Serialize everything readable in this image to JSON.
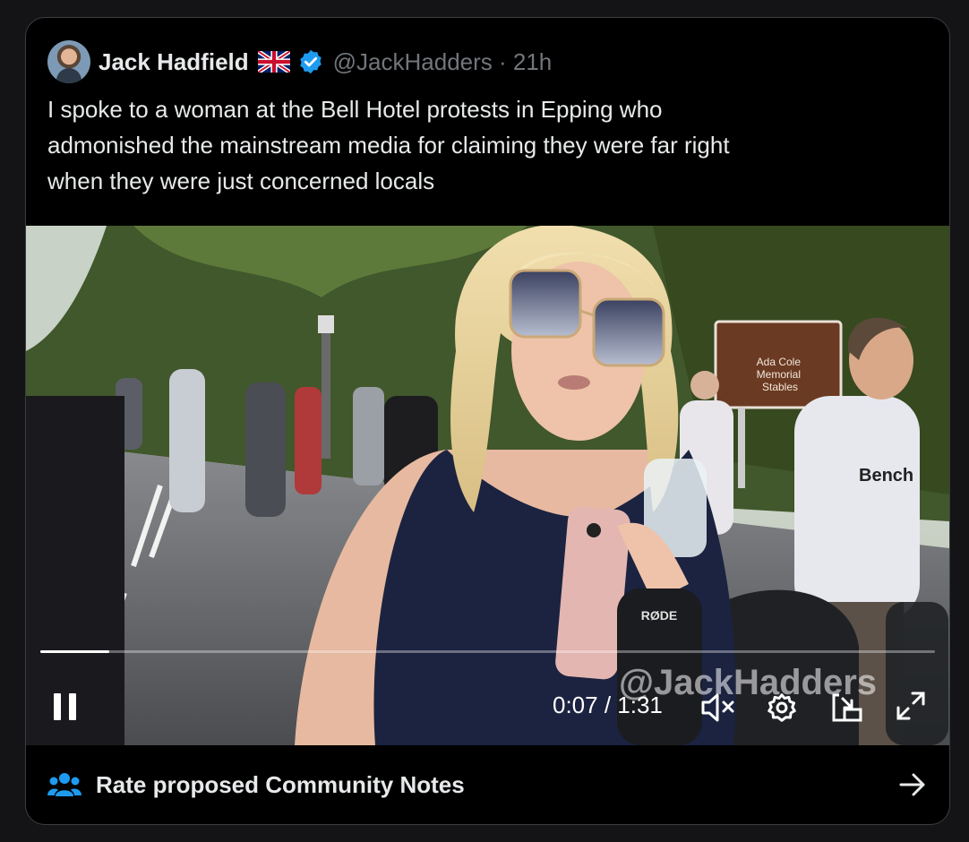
{
  "tweet": {
    "author_name": "Jack Hadfield",
    "handle_time": "@JackHadders · 21h",
    "text": "I spoke to a woman at the Bell Hotel protests in Epping who\nadmonished the mainstream media for claiming they were far right\nwhen they were just concerned locals"
  },
  "video": {
    "watermark": "@JackHadders",
    "current_time": "0:07",
    "duration": "1:31",
    "time_display": "0:07 / 1:31",
    "progress_fraction": 0.077,
    "sign_text": "Ada Cole\nMemorial\nStables",
    "shirt_text": "Bench",
    "mic_text": "RØDE"
  },
  "icons": {
    "author_flag": "uk-flag-icon",
    "verified": "verified-badge-icon",
    "pause": "pause-icon",
    "mute": "volume-muted-icon",
    "settings": "gear-icon",
    "minimize": "pop-out-icon",
    "fullscreen": "fullscreen-icon",
    "community": "community-notes-icon",
    "arrow": "arrow-right-icon"
  },
  "community_notes": {
    "label": "Rate proposed Community Notes"
  },
  "colors": {
    "background": "#000000",
    "text": "#e7e9ea",
    "secondary": "#71767b",
    "accent": "#1d9bf0"
  }
}
